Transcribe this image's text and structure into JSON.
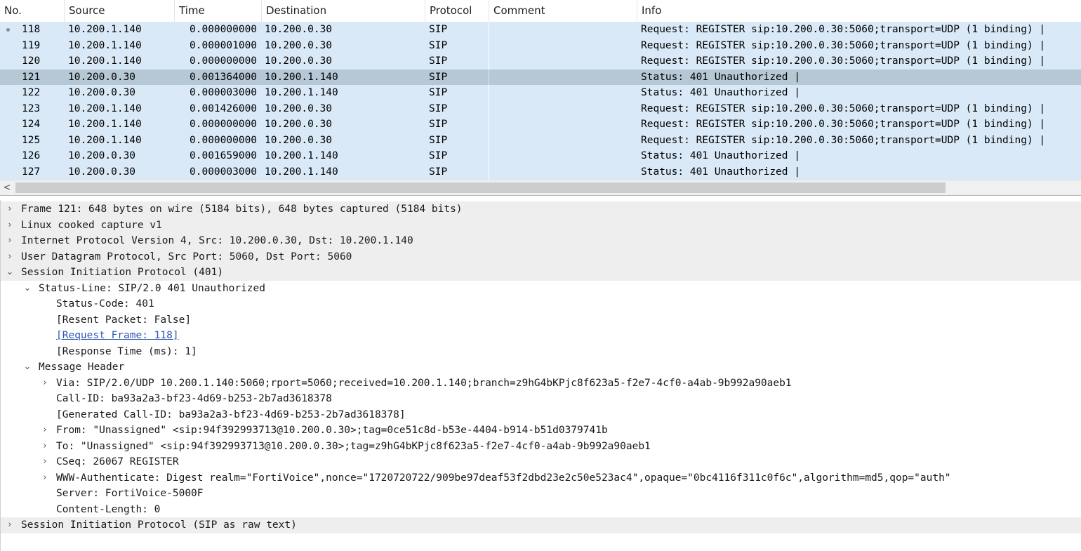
{
  "packet_list": {
    "columns": [
      "No.",
      "Source",
      "Time",
      "Destination",
      "Protocol",
      "Comment",
      "Info"
    ],
    "rows": [
      {
        "no": "118",
        "source": "10.200.1.140",
        "time": "0.000000000",
        "destination": "10.200.0.30",
        "protocol": "SIP",
        "comment": "",
        "info": "Request: REGISTER sip:10.200.0.30:5060;transport=UDP  (1 binding) |",
        "marker": "•"
      },
      {
        "no": "119",
        "source": "10.200.1.140",
        "time": "0.000001000",
        "destination": "10.200.0.30",
        "protocol": "SIP",
        "comment": "",
        "info": "Request: REGISTER sip:10.200.0.30:5060;transport=UDP  (1 binding) |",
        "marker": ""
      },
      {
        "no": "120",
        "source": "10.200.1.140",
        "time": "0.000000000",
        "destination": "10.200.0.30",
        "protocol": "SIP",
        "comment": "",
        "info": "Request: REGISTER sip:10.200.0.30:5060;transport=UDP  (1 binding) |",
        "marker": ""
      },
      {
        "no": "121",
        "source": "10.200.0.30",
        "time": "0.001364000",
        "destination": "10.200.1.140",
        "protocol": "SIP",
        "comment": "",
        "info": "Status: 401 Unauthorized |",
        "marker": ""
      },
      {
        "no": "122",
        "source": "10.200.0.30",
        "time": "0.000003000",
        "destination": "10.200.1.140",
        "protocol": "SIP",
        "comment": "",
        "info": "Status: 401 Unauthorized |",
        "marker": ""
      },
      {
        "no": "123",
        "source": "10.200.1.140",
        "time": "0.001426000",
        "destination": "10.200.0.30",
        "protocol": "SIP",
        "comment": "",
        "info": "Request: REGISTER sip:10.200.0.30:5060;transport=UDP  (1 binding) |",
        "marker": ""
      },
      {
        "no": "124",
        "source": "10.200.1.140",
        "time": "0.000000000",
        "destination": "10.200.0.30",
        "protocol": "SIP",
        "comment": "",
        "info": "Request: REGISTER sip:10.200.0.30:5060;transport=UDP  (1 binding) |",
        "marker": ""
      },
      {
        "no": "125",
        "source": "10.200.1.140",
        "time": "0.000000000",
        "destination": "10.200.0.30",
        "protocol": "SIP",
        "comment": "",
        "info": "Request: REGISTER sip:10.200.0.30:5060;transport=UDP  (1 binding) |",
        "marker": ""
      },
      {
        "no": "126",
        "source": "10.200.0.30",
        "time": "0.001659000",
        "destination": "10.200.1.140",
        "protocol": "SIP",
        "comment": "",
        "info": "Status: 401 Unauthorized |",
        "marker": ""
      },
      {
        "no": "127",
        "source": "10.200.0.30",
        "time": "0.000003000",
        "destination": "10.200.1.140",
        "protocol": "SIP",
        "comment": "",
        "info": "Status: 401 Unauthorized |",
        "marker": ""
      }
    ],
    "selected_no": "121"
  },
  "scrollbar": {
    "left_arrow": "<"
  },
  "details": {
    "collapsed_glyph": "›",
    "expanded_glyph": "⌄",
    "items": [
      {
        "level": 0,
        "state": "collapsed",
        "text": "Frame 121: 648 bytes on wire (5184 bits), 648 bytes captured (5184 bits)",
        "shade": true
      },
      {
        "level": 0,
        "state": "collapsed",
        "text": "Linux cooked capture v1",
        "shade": true
      },
      {
        "level": 0,
        "state": "collapsed",
        "text": "Internet Protocol Version 4, Src: 10.200.0.30, Dst: 10.200.1.140",
        "shade": true
      },
      {
        "level": 0,
        "state": "collapsed",
        "text": "User Datagram Protocol, Src Port: 5060, Dst Port: 5060",
        "shade": true
      },
      {
        "level": 0,
        "state": "expanded",
        "text": "Session Initiation Protocol (401)",
        "shade": true
      },
      {
        "level": 1,
        "state": "expanded",
        "text": "Status-Line: SIP/2.0 401 Unauthorized",
        "shade": false
      },
      {
        "level": 2,
        "state": "leaf",
        "text": "Status-Code: 401",
        "shade": false
      },
      {
        "level": 2,
        "state": "leaf",
        "text": "[Resent Packet: False]",
        "shade": false
      },
      {
        "level": 2,
        "state": "link",
        "text": "[Request Frame: 118]",
        "shade": false
      },
      {
        "level": 2,
        "state": "leaf",
        "text": "[Response Time (ms): 1]",
        "shade": false
      },
      {
        "level": 1,
        "state": "expanded",
        "text": "Message Header",
        "shade": false
      },
      {
        "level": 2,
        "state": "collapsed",
        "text": "Via: SIP/2.0/UDP 10.200.1.140:5060;rport=5060;received=10.200.1.140;branch=z9hG4bKPjc8f623a5-f2e7-4cf0-a4ab-9b992a90aeb1",
        "shade": false
      },
      {
        "level": 2,
        "state": "leaf",
        "text": "Call-ID: ba93a2a3-bf23-4d69-b253-2b7ad3618378",
        "shade": false
      },
      {
        "level": 2,
        "state": "leaf",
        "text": "[Generated Call-ID: ba93a2a3-bf23-4d69-b253-2b7ad3618378]",
        "shade": false
      },
      {
        "level": 2,
        "state": "collapsed",
        "text": "From: \"Unassigned\" <sip:94f392993713@10.200.0.30>;tag=0ce51c8d-b53e-4404-b914-b51d0379741b",
        "shade": false
      },
      {
        "level": 2,
        "state": "collapsed",
        "text": "To: \"Unassigned\" <sip:94f392993713@10.200.0.30>;tag=z9hG4bKPjc8f623a5-f2e7-4cf0-a4ab-9b992a90aeb1",
        "shade": false
      },
      {
        "level": 2,
        "state": "collapsed",
        "text": "CSeq: 26067 REGISTER",
        "shade": false
      },
      {
        "level": 2,
        "state": "collapsed",
        "text": "WWW-Authenticate: Digest realm=\"FortiVoice\",nonce=\"1720720722/909be97deaf53f2dbd23e2c50e523ac4\",opaque=\"0bc4116f311c0f6c\",algorithm=md5,qop=\"auth\"",
        "shade": false
      },
      {
        "level": 2,
        "state": "leaf",
        "text": "Server: FortiVoice-5000F",
        "shade": false
      },
      {
        "level": 2,
        "state": "leaf",
        "text": "Content-Length:  0",
        "shade": false
      },
      {
        "level": 0,
        "state": "collapsed",
        "text": "Session Initiation Protocol (SIP as raw text)",
        "shade": true
      }
    ]
  },
  "colors": {
    "row_bg": "#dae9f8",
    "selected_bg": "#b6c8d6",
    "link": "#2b57b4",
    "shade": "#eeeeee"
  }
}
